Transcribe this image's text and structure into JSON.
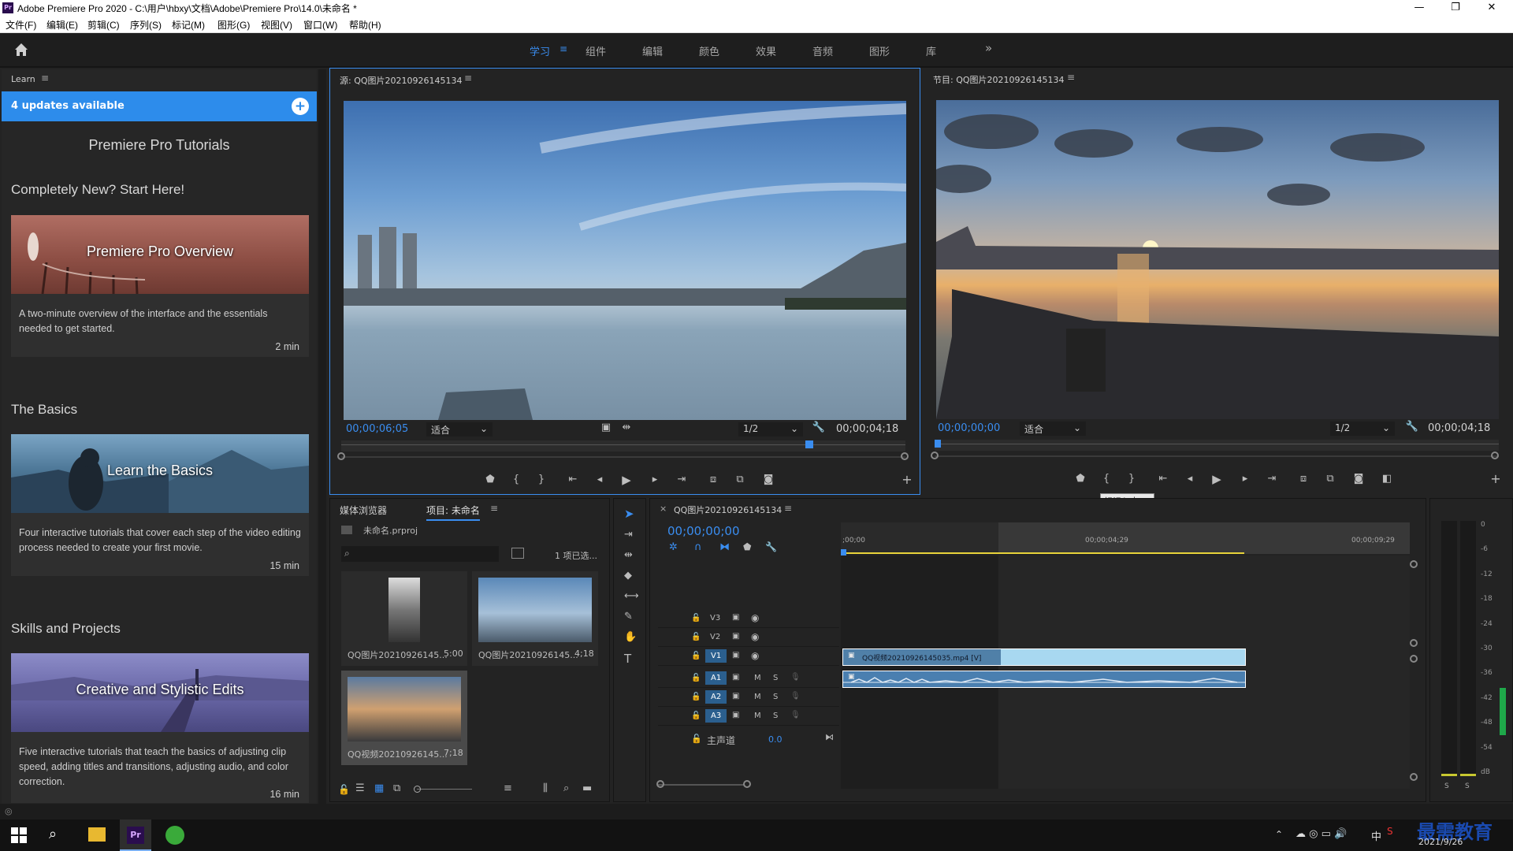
{
  "window": {
    "title": "Adobe Premiere Pro 2020 - C:\\用户\\hbxy\\文档\\Adobe\\Premiere Pro\\14.0\\未命名 *",
    "logo": "Pr",
    "minimize": "—",
    "restore": "❐",
    "close": "✕"
  },
  "menu": [
    "文件(F)",
    "编辑(E)",
    "剪辑(C)",
    "序列(S)",
    "标记(M)",
    "图形(G)",
    "视图(V)",
    "窗口(W)",
    "帮助(H)"
  ],
  "workspaces": {
    "tabs": [
      "学习",
      "组件",
      "编辑",
      "颜色",
      "效果",
      "音频",
      "图形",
      "库"
    ],
    "active": "学习",
    "more": "»"
  },
  "learn": {
    "header": "Learn",
    "updates": "4 updates available",
    "updates_icon": "+",
    "title": "Premiere Pro Tutorials",
    "sections": [
      {
        "heading": "Completely New? Start Here!",
        "card_title": "Premiere Pro Overview",
        "description": "A two-minute overview of the interface and the essentials needed to get started.",
        "duration": "2 min"
      },
      {
        "heading": "The Basics",
        "card_title": "Learn the Basics",
        "description": "Four interactive tutorials that cover each step of the video editing process needed to create your first movie.",
        "duration": "15 min"
      },
      {
        "heading": "Skills and Projects",
        "card_title": "Creative and Stylistic Edits",
        "description": "Five interactive tutorials that teach the basics of adjusting clip speed, adding titles and transitions, adjusting audio, and color correction.",
        "duration": "16 min"
      }
    ]
  },
  "source_monitor": {
    "title": "源: QQ图片20210926145134",
    "timecode": "00;00;06;05",
    "fit": "适合",
    "resolution": "1/2",
    "duration": "00;00;04;18",
    "playhead": 0.83
  },
  "program_monitor": {
    "title": "节目: QQ图片20210926145134",
    "timecode": "00;00;00;00",
    "fit": "适合",
    "resolution": "1/2",
    "duration": "00;00;04;18",
    "tooltip": "标记入点 (I)",
    "playhead": 0.0
  },
  "project": {
    "tabs": [
      "媒体浏览器",
      "项目: 未命名"
    ],
    "active_tab": "项目: 未命名",
    "file": "未命名.prproj",
    "selection": "1 项已选...",
    "search_placeholder": "",
    "items": [
      {
        "name": "QQ图片20210926145...",
        "duration": "5:00"
      },
      {
        "name": "QQ图片20210926145...",
        "duration": "4;18"
      },
      {
        "name": "QQ视频20210926145...",
        "duration": "7;18"
      }
    ]
  },
  "timeline": {
    "close": "×",
    "sequence": "QQ图片20210926145134",
    "timecode": "00;00;00;00",
    "ruler": [
      ";00;00",
      "00;00;04;29",
      "00;00;09;29"
    ],
    "video_tracks": [
      "V3",
      "V2",
      "V1"
    ],
    "audio_tracks": [
      "A1",
      "A2",
      "A3"
    ],
    "master": "主声道",
    "master_value": "0.0",
    "clip_video": "QQ视频20210926145035.mp4 [V]",
    "track_buttons": [
      "M",
      "S"
    ]
  },
  "meter": {
    "scale": [
      "0",
      "-6",
      "-12",
      "-18",
      "-24",
      "-30",
      "-36",
      "-42",
      "-48",
      "-54",
      "dB"
    ],
    "solo": [
      "S",
      "S"
    ]
  },
  "taskbar": {
    "clock_time": "",
    "clock_date": "2021/9/26",
    "ime": "中",
    "watermark": "最需教育"
  },
  "colors": {
    "accent": "#2d8ceb",
    "clip_video": "#a8d8f0",
    "clip_audio": "#4a7fb0",
    "in_out_bar": "#e8d33a"
  }
}
